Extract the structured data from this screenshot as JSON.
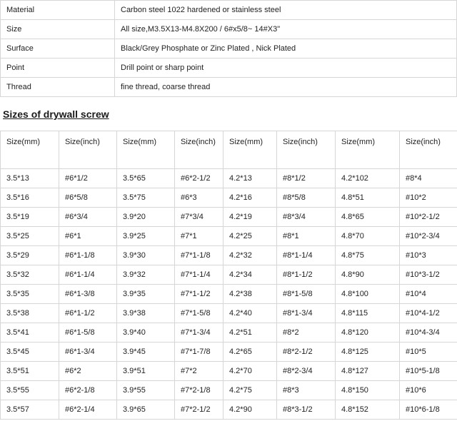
{
  "specs": [
    {
      "label": "Material",
      "value": "Carbon steel 1022 hardened or stainless steel"
    },
    {
      "label": "Size",
      "value": "All size,M3.5X13-M4.8X200 / 6#x5/8~ 14#X3\""
    },
    {
      "label": "Surface",
      "value": "Black/Grey Phosphate or Zinc Plated , Nick Plated"
    },
    {
      "label": "Point",
      "value": "Drill point or sharp point"
    },
    {
      "label": "Thread",
      "value": "fine thread, coarse thread"
    }
  ],
  "section_title": "Sizes of drywall screw",
  "size_table": {
    "headers": [
      "Size(mm)",
      "Size(inch)",
      "Size(mm)",
      "Size(inch)",
      "Size(mm)",
      "Size(inch)",
      "Size(mm)",
      "Size(inch)"
    ],
    "rows": [
      [
        "3.5*13",
        "#6*1/2",
        "3.5*65",
        "#6*2-1/2",
        "4.2*13",
        "#8*1/2",
        "4.2*102",
        "#8*4"
      ],
      [
        "3.5*16",
        "#6*5/8",
        "3.5*75",
        "#6*3",
        "4.2*16",
        "#8*5/8",
        "4.8*51",
        "#10*2"
      ],
      [
        "3.5*19",
        "#6*3/4",
        "3.9*20",
        "#7*3/4",
        "4.2*19",
        "#8*3/4",
        "4.8*65",
        "#10*2-1/2"
      ],
      [
        "3.5*25",
        "#6*1",
        "3.9*25",
        "#7*1",
        "4.2*25",
        "#8*1",
        "4.8*70",
        "#10*2-3/4"
      ],
      [
        "3.5*29",
        "#6*1-1/8",
        "3.9*30",
        "#7*1-1/8",
        "4.2*32",
        "#8*1-1/4",
        "4.8*75",
        "#10*3"
      ],
      [
        "3.5*32",
        "#6*1-1/4",
        "3.9*32",
        "#7*1-1/4",
        "4.2*34",
        "#8*1-1/2",
        "4.8*90",
        "#10*3-1/2"
      ],
      [
        "3.5*35",
        "#6*1-3/8",
        "3.9*35",
        "#7*1-1/2",
        "4.2*38",
        "#8*1-5/8",
        "4.8*100",
        "#10*4"
      ],
      [
        "3.5*38",
        "#6*1-1/2",
        "3.9*38",
        "#7*1-5/8",
        "4.2*40",
        "#8*1-3/4",
        "4.8*115",
        "#10*4-1/2"
      ],
      [
        "3.5*41",
        "#6*1-5/8",
        "3.9*40",
        "#7*1-3/4",
        "4.2*51",
        "#8*2",
        "4.8*120",
        "#10*4-3/4"
      ],
      [
        "3.5*45",
        "#6*1-3/4",
        "3.9*45",
        "#7*1-7/8",
        "4.2*65",
        "#8*2-1/2",
        "4.8*125",
        "#10*5"
      ],
      [
        "3.5*51",
        "#6*2",
        "3.9*51",
        "#7*2",
        "4.2*70",
        "#8*2-3/4",
        "4.8*127",
        "#10*5-1/8"
      ],
      [
        "3.5*55",
        "#6*2-1/8",
        "3.9*55",
        "#7*2-1/8",
        "4.2*75",
        "#8*3",
        "4.8*150",
        "#10*6"
      ],
      [
        "3.5*57",
        "#6*2-1/4",
        "3.9*65",
        "#7*2-1/2",
        "4.2*90",
        "#8*3-1/2",
        "4.8*152",
        "#10*6-1/8"
      ]
    ]
  }
}
